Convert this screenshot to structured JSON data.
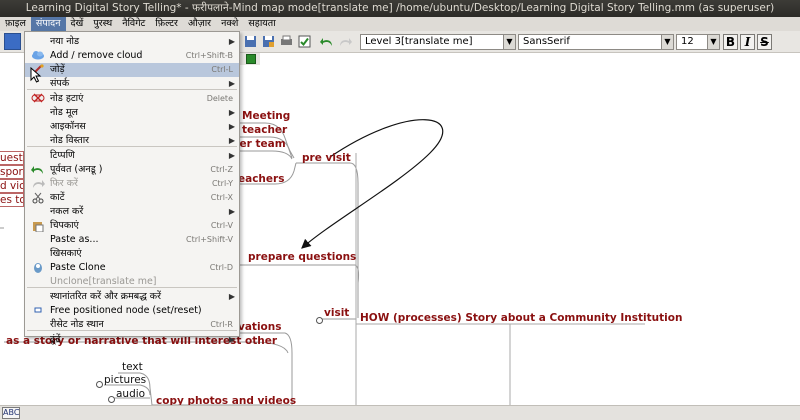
{
  "window": {
    "title": "Learning Digital Story Telling* - फरीपलाने-Mind map mode[translate me] /home/ubuntu/Desktop/Learning Digital Story Telling.mm (as superuser)"
  },
  "menubar": {
    "items": [
      {
        "label": "फ़ाइल"
      },
      {
        "label": "संपादन"
      },
      {
        "label": "देखें"
      },
      {
        "label": "पुरस्थ"
      },
      {
        "label": "नैविगेट"
      },
      {
        "label": "फ़िल्टर"
      },
      {
        "label": "औज़ार"
      },
      {
        "label": "नक्शे"
      },
      {
        "label": "सहायता"
      }
    ],
    "active_index": 1
  },
  "toolbar": {
    "style_combo": "Level 3[translate me]",
    "font_combo": "SansSerif",
    "size_combo": "12",
    "bold_label": "B",
    "italic_label": "I",
    "strike_label": "S"
  },
  "edit_menu": {
    "items": [
      {
        "label": "नया नोड",
        "accel": "",
        "submenu": true,
        "icon": "",
        "disabled": false,
        "highlighted": false
      },
      {
        "label": "Add / remove cloud",
        "accel": "Ctrl+Shift-B",
        "submenu": false,
        "icon": "cloud-icon",
        "disabled": false,
        "highlighted": false
      },
      {
        "label": "जोड़ें",
        "accel": "Ctrl-L",
        "submenu": false,
        "icon": "link-icon",
        "disabled": false,
        "highlighted": true
      },
      {
        "label": "संपर्क",
        "accel": "",
        "submenu": true,
        "icon": "",
        "disabled": false,
        "highlighted": false
      },
      {
        "label": "नोड हटाएं",
        "accel": "Delete",
        "submenu": false,
        "icon": "delete-node-icon",
        "disabled": false,
        "highlighted": false
      },
      {
        "label": "नोड मूल",
        "accel": "",
        "submenu": true,
        "icon": "",
        "disabled": false,
        "highlighted": false
      },
      {
        "label": "आइकॉनस",
        "accel": "",
        "submenu": true,
        "icon": "",
        "disabled": false,
        "highlighted": false
      },
      {
        "label": "नोड विस्तार",
        "accel": "",
        "submenu": true,
        "icon": "",
        "disabled": false,
        "highlighted": false
      },
      {
        "label": "टिप्पणि",
        "accel": "",
        "submenu": true,
        "icon": "",
        "disabled": false,
        "highlighted": false
      },
      {
        "label": "पूर्ववत (अनडू )",
        "accel": "Ctrl-Z",
        "submenu": false,
        "icon": "undo-icon",
        "disabled": false,
        "highlighted": false
      },
      {
        "label": "फिर करें",
        "accel": "Ctrl-Y",
        "submenu": false,
        "icon": "redo-icon",
        "disabled": true,
        "highlighted": false
      },
      {
        "label": "काटें",
        "accel": "Ctrl-X",
        "submenu": false,
        "icon": "cut-icon",
        "disabled": false,
        "highlighted": false
      },
      {
        "label": "नकल करें",
        "accel": "",
        "submenu": true,
        "icon": "",
        "disabled": false,
        "highlighted": false
      },
      {
        "label": "चिपकाएं",
        "accel": "Ctrl-V",
        "submenu": false,
        "icon": "paste-icon",
        "disabled": false,
        "highlighted": false
      },
      {
        "label": "Paste as...",
        "accel": "Ctrl+Shift-V",
        "submenu": false,
        "icon": "",
        "disabled": false,
        "highlighted": false
      },
      {
        "label": "खिसकाएं",
        "accel": "",
        "submenu": false,
        "icon": "",
        "disabled": false,
        "highlighted": false
      },
      {
        "label": "Paste Clone",
        "accel": "Ctrl-D",
        "submenu": false,
        "icon": "clone-icon",
        "disabled": false,
        "highlighted": false
      },
      {
        "label": "Unclone[translate me]",
        "accel": "",
        "submenu": false,
        "icon": "",
        "disabled": true,
        "highlighted": false
      },
      {
        "label": "स्थानांतरित करें और क्रमबद्ध करें",
        "accel": "",
        "submenu": true,
        "icon": "",
        "disabled": false,
        "highlighted": false
      },
      {
        "label": "Free positioned node (set/reset)",
        "accel": "",
        "submenu": false,
        "icon": "free-node-icon",
        "disabled": false,
        "highlighted": false
      },
      {
        "label": "रीसेट नोड स्थान",
        "accel": "Ctrl-R",
        "submenu": false,
        "icon": "",
        "disabled": false,
        "highlighted": false
      },
      {
        "label": "ढूंढें",
        "accel": "",
        "submenu": true,
        "icon": "",
        "disabled": false,
        "highlighted": false
      }
    ]
  },
  "mindmap": {
    "nodes": {
      "meeting": "Meeting",
      "teacher": "teacher",
      "team": "per team",
      "teachers": "eachers",
      "pre_visit": "pre visit",
      "prepare_questions": "prepare questions",
      "visit": "visit",
      "how": "HOW (processes) Story about a Community Institution",
      "observations": "vations",
      "story": "as a story or narrative that will interest other",
      "text": "text",
      "pictures": "pictures",
      "audio": "audio",
      "copy_photos": "copy photos and videos",
      "left_1": "uest",
      "left_2": "spor",
      "left_3": "d vic",
      "left_4": "es to"
    }
  },
  "statusbar": {
    "abc_label": "ABC"
  }
}
